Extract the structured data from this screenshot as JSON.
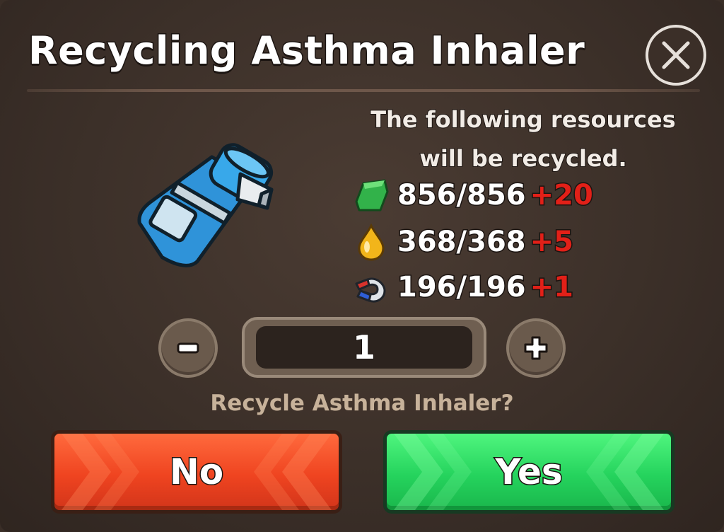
{
  "dialog": {
    "title": "Recycling Asthma Inhaler",
    "description": "The following resources will be recycled.",
    "item": {
      "name": "Asthma Inhaler",
      "icon": "asthma-inhaler-icon"
    },
    "resources": [
      {
        "icon": "cloth-icon",
        "amount": "856/856",
        "bonus": "+20"
      },
      {
        "icon": "fuel-drop-icon",
        "amount": "368/368",
        "bonus": "+5"
      },
      {
        "icon": "magnet-icon",
        "amount": "196/196",
        "bonus": "+1"
      }
    ],
    "quantity": "1",
    "prompt": "Recycle Asthma Inhaler?",
    "no_label": "No",
    "yes_label": "Yes",
    "colors": {
      "bonus": "#e22018",
      "no_button": "#ef4420",
      "yes_button": "#25d35d"
    }
  }
}
